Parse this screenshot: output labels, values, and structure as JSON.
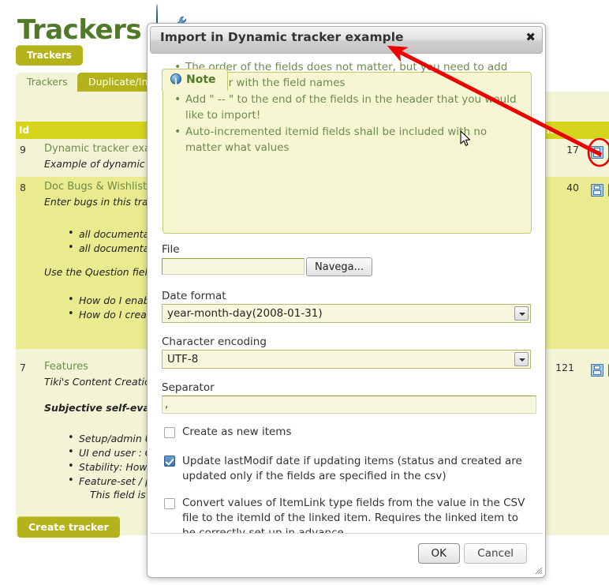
{
  "page": {
    "title": "Trackers",
    "icons": [
      "help-icon",
      "wrench-icon"
    ],
    "trackers_button": "Trackers",
    "create_tracker_button": "Create tracker",
    "tabs": [
      {
        "label": "Trackers",
        "active": true
      },
      {
        "label": "Duplicate/Impo",
        "active": false
      }
    ],
    "table": {
      "columns": [
        "Id",
        "Items"
      ],
      "rows": [
        {
          "id": "9",
          "name": "Dynamic tracker example",
          "description": "Example of dynamic trackers",
          "items": "17",
          "extra_lines": []
        },
        {
          "id": "8",
          "name": "Doc Bugs & Wishlist",
          "description": "Enter bugs in this tracker for",
          "items": "40",
          "extra_lines": [
            "all documentation pro",
            "all documentation tha",
            "Use the Question field to ent",
            "How do I enable Blog",
            "How do I create a tab"
          ]
        },
        {
          "id": "7",
          "name": "Features",
          "description": "Tiki's Content Creation and M",
          "items": "121",
          "extra_lines": [
            "Subjective self-evaluation b",
            "Setup/admin UI: How",
            "UI end user : Once s",
            "Stability: How many ",
            "Feature-set / power: ",
            "This field is the defau"
          ]
        }
      ],
      "row_icons": [
        "save-icon",
        "import-icon"
      ]
    }
  },
  "dialog": {
    "title": "Import in Dynamic tracker example",
    "close_label": "✖",
    "note": {
      "tab_label": "Note",
      "icon": "info-icon",
      "dismiss_icon": "close-circle-icon",
      "bullets": [
        "The order of the fields does not matter, but you need to add a header with the field names",
        "Add \" -- \" to the end of the fields in the header that you would like to import!",
        "Auto-incremented itemid fields shall be included with no matter what values"
      ]
    },
    "fields": {
      "file": {
        "label": "File",
        "value": "",
        "placeholder": "",
        "browse_button": "Navega..."
      },
      "date_format": {
        "label": "Date format",
        "value": "year-month-day(2008-01-31)"
      },
      "character_encoding": {
        "label": "Character encoding",
        "value": "UTF-8"
      },
      "separator": {
        "label": "Separator",
        "value": ","
      }
    },
    "checkboxes": [
      {
        "label": "Create as new items",
        "checked": false
      },
      {
        "label": "Update lastModif date if updating items (status and created are updated only if the fields are specified in the csv)",
        "checked": true
      },
      {
        "label": "Convert values of ItemLink type fields from the value in the CSV file to the itemId of the linked item. Requires the linked item to be correctly set up in advance.",
        "checked": false
      }
    ],
    "buttons": {
      "ok": "OK",
      "cancel": "Cancel"
    }
  },
  "annotation": {
    "arrow_color": "#ee0000",
    "highlight_shape": "ellipse",
    "cursor": "arrow-pointer"
  }
}
